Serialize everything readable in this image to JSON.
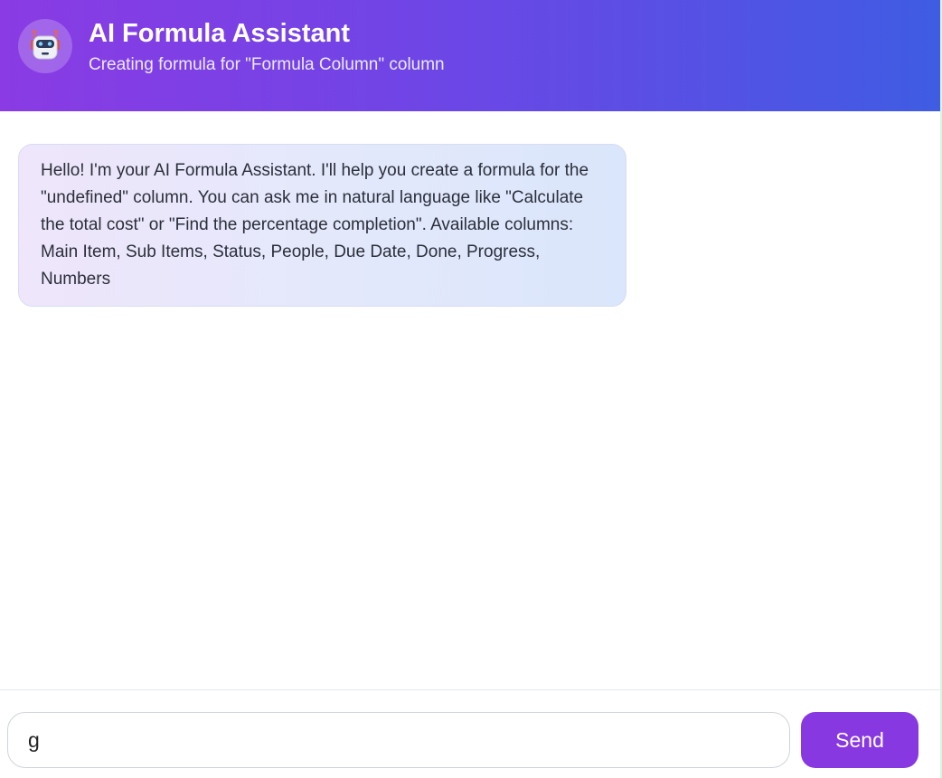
{
  "header": {
    "avatar_icon": "robot-icon",
    "title": "AI Formula Assistant",
    "subtitle": "Creating formula for \"Formula Column\" column"
  },
  "messages": [
    {
      "role": "assistant",
      "text": "Hello! I'm your AI Formula Assistant. I'll help you create a formula for the \"undefined\" column. You can ask me in natural language like \"Calculate the total cost\" or \"Find the percentage completion\". Available columns: Main Item, Sub Items, Status, People, Due Date, Done, Progress, Numbers"
    }
  ],
  "composer": {
    "input_value": "g",
    "send_label": "Send"
  },
  "colors": {
    "header_gradient_start": "#8a3be3",
    "header_gradient_end": "#3f5ce3",
    "send_button": "#8838e0",
    "bubble_border": "#d8dcf3"
  }
}
